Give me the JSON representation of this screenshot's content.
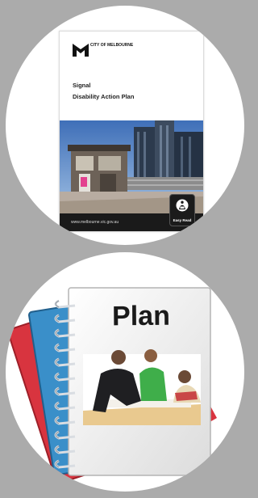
{
  "cover": {
    "logo_text": "CITY OF MELBOURNE",
    "title": "Signal",
    "subtitle": "Disability Action Plan",
    "footer_url": "www.melbourne.vic.gov.au",
    "badge_label": "Easy Read",
    "icons": {
      "logo": "city-of-melbourne-logo",
      "badge": "easy-read-person-icon"
    }
  },
  "plan": {
    "label": "Plan",
    "icons": {
      "binders": "stacked-binders-illustration",
      "photo": "people-planning-photo"
    },
    "colors": {
      "red_binder": "#d8343f",
      "blue_binder": "#3a8fc9"
    }
  },
  "colors": {
    "background": "#ababab",
    "circle": "#ffffff"
  }
}
